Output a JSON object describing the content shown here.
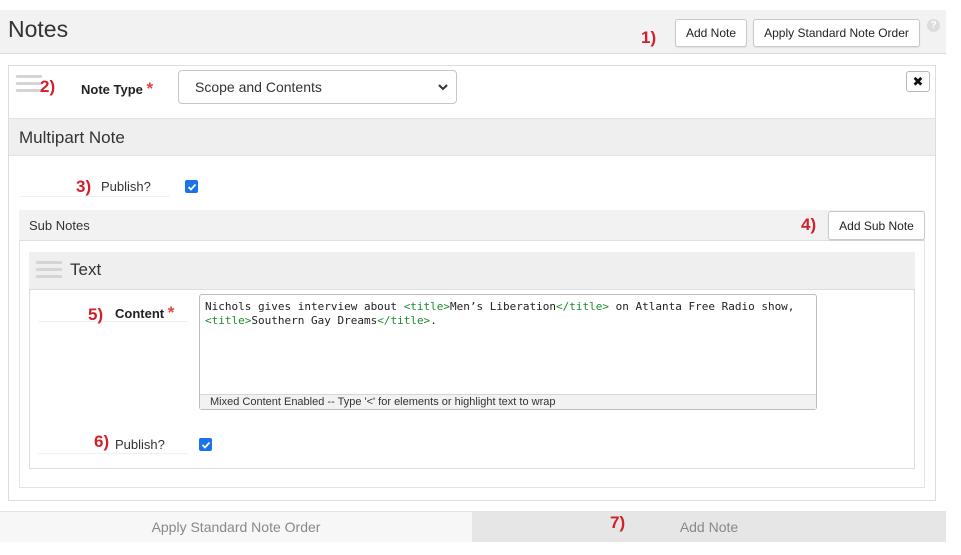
{
  "header": {
    "title": "Notes",
    "add_note_label": "Add Note",
    "apply_order_label": "Apply Standard Note Order",
    "help_glyph": "?"
  },
  "annotations": [
    "1)",
    "2)",
    "3)",
    "4)",
    "5)",
    "6)",
    "7)"
  ],
  "note": {
    "type_label": "Note Type",
    "required_mark": "*",
    "type_value": "Scope and Contents",
    "close_glyph": "✖",
    "multipart_title": "Multipart Note",
    "publish_label": "Publish?",
    "publish_checked": true
  },
  "subnotes": {
    "title": "Sub Notes",
    "add_sub_note_label": "Add Sub Note",
    "text_title": "Text",
    "content_label": "Content",
    "content_segments": [
      {
        "text": "Nichols gives interview about ",
        "tag": false
      },
      {
        "text": "<title>",
        "tag": true
      },
      {
        "text": "Men’s Liberation",
        "tag": false
      },
      {
        "text": "</title>",
        "tag": true
      },
      {
        "text": " on Atlanta Free Radio show, ",
        "tag": false
      },
      {
        "text": "<title>",
        "tag": true
      },
      {
        "text": "Southern Gay Dreams",
        "tag": false
      },
      {
        "text": "</title>",
        "tag": true
      },
      {
        "text": ".",
        "tag": false
      }
    ],
    "mixed_content_hint": "Mixed Content Enabled  --  Type '<' for elements or highlight text to wrap",
    "publish_label": "Publish?",
    "publish_checked": true
  },
  "footer": {
    "apply_order_label": "Apply Standard Note Order",
    "add_note_label": "Add Note"
  },
  "colors": {
    "annotation_red": "#d1202b",
    "checkbox_blue": "#1a73e8",
    "tag_green": "#1f8a2e"
  }
}
